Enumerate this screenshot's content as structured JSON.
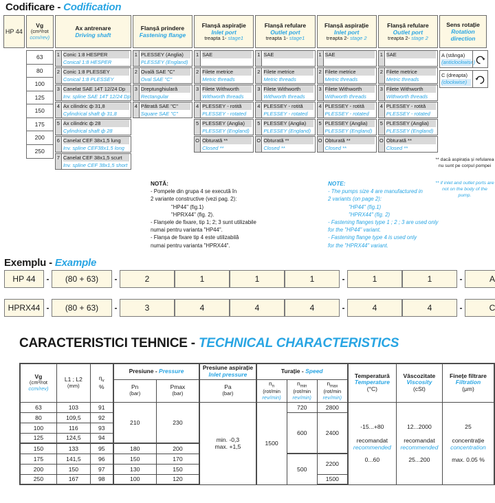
{
  "titles": {
    "codification_ro": "Codificare",
    "codification_sep": " - ",
    "codification_en": "Codification",
    "example_ro": "Exemplu",
    "example_sep": " - ",
    "example_en": "Example",
    "tech_ro": "CARACTERISTICI TEHNICE",
    "tech_sep": " - ",
    "tech_en": "TECHNICAL CHARACTERISTICS"
  },
  "codification": {
    "model_label": "HP 44",
    "headers": {
      "vg_ro": "Vg",
      "vg_unit_ro": "(cm³/rot",
      "vg_unit_en": "ccm/rev)",
      "shaft_ro": "Ax antrenare",
      "shaft_en": "Driving shaft",
      "flange_ro": "Flanșă prindere",
      "flange_en": "Fastening flange",
      "inlet1_ro": "Flanșă aspirație",
      "inlet1_en": "Inlet port",
      "inlet1_stage_ro": "treapta 1-",
      "inlet1_stage_en": " stage1",
      "outlet1_ro": "Flanșă refulare",
      "outlet1_en": "Outlet port",
      "outlet1_stage_ro": "treapta 1-",
      "outlet1_stage_en": " stage1",
      "inlet2_ro": "Flanșă aspirație",
      "inlet2_en": "Inlet port",
      "inlet2_stage_ro": "treapta 2-",
      "inlet2_stage_en": " stage 2",
      "outlet2_ro": "Flanșă refulare",
      "outlet2_en": "Outlet port",
      "outlet2_stage_ro": "treapta 2-",
      "outlet2_stage_en": " stage 2",
      "rotation_ro": "Sens rotație",
      "rotation_en1": "Rotation",
      "rotation_en2": "direction"
    },
    "vg_values": [
      "63",
      "80",
      "100",
      "125",
      "150",
      "175",
      "200",
      "250"
    ],
    "shaft_options": [
      {
        "num": "1",
        "ro": "Conic   1:8  HESPER",
        "en": "Conical 1:8 HESPER"
      },
      {
        "num": "2",
        "ro": "Conic  1:8  PLESSEY",
        "en": "Conical 1:8 PLESSEY"
      },
      {
        "num": "3",
        "ro": "Canelat SAE 14T 12/24 Dp",
        "en": "Inv. spline SAE 14T 12/24 Dp"
      },
      {
        "num": "4",
        "ro": "Ax cilindric ф 31,8",
        "en": "Cylindrical shaft ф 31,8"
      },
      {
        "num": "5",
        "ro": "Ax cilindric ф 28",
        "en": "Cylindrical shaft ф 28"
      },
      {
        "num": "6",
        "ro": "Canelat CEF 38x1,5 lung",
        "en": "Inv. spline CEF38x1,5 long"
      },
      {
        "num": "7",
        "ro": "Canelat CEF 38x1,5 scurt",
        "en": "Inv. spline CEF 38x1,5 short"
      }
    ],
    "flange_options": [
      {
        "num": "1",
        "ro": "PLESSEY (Anglia)",
        "en": "PLESSEY (England)"
      },
      {
        "num": "2",
        "ro": "Ovală SAE \"C\"",
        "en": "Oval SAE \"C\""
      },
      {
        "num": "3",
        "ro": "Dreptunghiulară",
        "en": "Rectangular"
      },
      {
        "num": "4",
        "ro": "Pătrată SAE \"C\"",
        "en": "Square SAE \"C\""
      }
    ],
    "port_options": [
      {
        "num": "1",
        "ro": "SAE",
        "en": ""
      },
      {
        "num": "2",
        "ro": "Filete metrice",
        "en": "Metric threads"
      },
      {
        "num": "3",
        "ro": "Filete Withworth",
        "en": "Withworth threads"
      },
      {
        "num": "4",
        "ro": "PLESSEY - rotită",
        "en": "PLESSEY - rotated"
      },
      {
        "num": "5",
        "ro": "PLESSEY (Anglia)",
        "en": "PLESSEY (England)"
      },
      {
        "num": "O",
        "ro": "Obturată  **",
        "en": "Closed  **"
      }
    ],
    "rotation_options": [
      {
        "ro": "A (stânga)",
        "en": "(anticlockwise)",
        "icon": "rotate-ccw-icon"
      },
      {
        "ro": "C (dreapta)",
        "en": "(clockwise)",
        "icon": "rotate-cw-icon"
      }
    ]
  },
  "notes": {
    "ro_title": "NOTĂ:",
    "ro_lines": [
      "- Pompele din grupa 4 se execută în",
      "  2 variante constructive (vezi pag. 2):"
    ],
    "ro_variants": [
      "\"HP44\"     (fig.1)",
      "\"HPRX44\"   (fig. 2)."
    ],
    "ro_lines2": [
      "- Flanșele de fixare, tip 1; 2; 3 sunt utilizabile",
      "  numai pentru varianta \"HP44\".",
      "- Flanșa de fixare tip 4 este utilizabilă",
      "  numai pentru varianta \"HPRX44\"."
    ],
    "en_title": "NOTE:",
    "en_lines": [
      "- The pumps size 4  are manufactured  in",
      "  2 variants (on page 2):"
    ],
    "en_variants": [
      "\"HP44\"    (fig.1)",
      "\"HPRX44\"  (fig. 2)"
    ],
    "en_lines2": [
      "- Fastening flanges type 1 ; 2 ; 3 are used  only",
      "   for the \"HP44\" variant.",
      "- Fastening flange type 4 is used  only",
      "   for the \"HPRX44\" variant."
    ],
    "footnote_ro": "**  dacă aspirația și refularea nu sunt pe corpul pompei",
    "footnote_en": "**  if inlet and outlet ports are not on the body of the pump."
  },
  "example": {
    "separator": "-",
    "rows": [
      {
        "model": "HP 44",
        "vg": "(80 + 63)",
        "codes": [
          "2",
          "1",
          "1",
          "1",
          "1",
          "1"
        ],
        "rotation": "A"
      },
      {
        "model": "HPRX44",
        "vg": "(80 + 63)",
        "codes": [
          "3",
          "4",
          "4",
          "4",
          "4",
          "4"
        ],
        "rotation": "C"
      }
    ]
  },
  "tech_table": {
    "headers": {
      "vg_ro": "Vg",
      "vg_unit_ro": "(cm³/rot",
      "vg_unit_en": "ccm/rev)",
      "l_label": "L1 ; L2",
      "l_unit": "(mm)",
      "eta_label": "η",
      "eta_sub": "v",
      "eta_unit": "%",
      "pressure_ro": "Presiune",
      "pressure_sep": " - ",
      "pressure_en": "Pressure",
      "pn": "Pn",
      "pn_unit": "(bar)",
      "pmax": "Pmax",
      "pmax_unit": "(bar)",
      "inlet_press_ro": "Presiune aspirație",
      "inlet_press_en": "Inlet pressure",
      "pa": "Pa",
      "pa_unit": "(bar)",
      "speed_ro": "Turație",
      "speed_sep": " - ",
      "speed_en": "Speed",
      "nn": "n",
      "nn_sub": "n",
      "nmin": "n",
      "nmin_sub": "min",
      "nmax": "n",
      "nmax_sub": "max",
      "rpm_ro": "(rot/min",
      "rpm_en": "rev/min)",
      "temp_ro": "Temperatură",
      "temp_en": "Temperature",
      "temp_unit": "(°C)",
      "visc_ro": "Vâscozitate",
      "visc_en": "Viscosity",
      "visc_unit": "(cSt)",
      "filt_ro": "Finețe filtrare",
      "filt_en": "Filtration",
      "filt_unit": "(μm)"
    },
    "rows": [
      {
        "vg": "63",
        "l": "103",
        "eta": "91"
      },
      {
        "vg": "80",
        "l": "109,5",
        "eta": "92"
      },
      {
        "vg": "100",
        "l": "116",
        "eta": "93"
      },
      {
        "vg": "125",
        "l": "124,5",
        "eta": "94"
      },
      {
        "vg": "150",
        "l": "133",
        "eta": "95"
      },
      {
        "vg": "175",
        "l": "141,5",
        "eta": "96"
      },
      {
        "vg": "200",
        "l": "150",
        "eta": "97"
      },
      {
        "vg": "250",
        "l": "167",
        "eta": "98"
      }
    ],
    "pressure_groups": [
      {
        "pn": "210",
        "pmax": "230",
        "span": 4
      },
      {
        "pn": "180",
        "pmax": "200",
        "span": 1
      },
      {
        "pn": "150",
        "pmax": "170",
        "span": 1
      },
      {
        "pn": "130",
        "pmax": "150",
        "span": 1
      },
      {
        "pn": "100",
        "pmax": "120",
        "span": 1
      }
    ],
    "pa_value_line1": "min. -0,3",
    "pa_value_line2": "max. +1,5",
    "nn_value": "1500",
    "nmin_groups": [
      {
        "value": "720",
        "span": 1
      },
      {
        "value": "600",
        "span": 4
      },
      {
        "value": "500",
        "span": 3
      }
    ],
    "nmax_groups": [
      {
        "value": "2800",
        "span": 1
      },
      {
        "value": "2400",
        "span": 4
      },
      {
        "value": "2200",
        "span": 2
      },
      {
        "value": "1500",
        "span": 1
      }
    ],
    "temperature": {
      "value": "-15...+80",
      "note_ro": "recomandat",
      "note_en": "recommended",
      "range": "0...60"
    },
    "viscosity": {
      "value": "12...2000",
      "note_ro": "recomandat",
      "note_en": "recommended",
      "range": "25...200"
    },
    "filtration": {
      "value": "25",
      "note_ro": "concentrație",
      "note_en": "concentration",
      "range": "max. 0.05 %"
    }
  }
}
